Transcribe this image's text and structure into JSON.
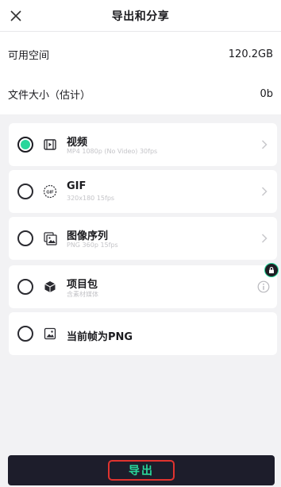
{
  "header": {
    "title": "导出和分享",
    "close_icon": "close-icon"
  },
  "info": {
    "space_label": "可用空间",
    "space_value": "120.2GB",
    "size_label": "文件大小（估计）",
    "size_value": "0b"
  },
  "options": [
    {
      "name": "视频",
      "desc": "MP4 1080p (No Video) 30fps",
      "icon": "video-icon",
      "selected": true,
      "trailing": "chevron-right-icon"
    },
    {
      "name": "GIF",
      "desc": "320x180 15fps",
      "icon": "gif-icon",
      "selected": false,
      "trailing": "chevron-right-icon"
    },
    {
      "name": "图像序列",
      "desc": "PNG 360p 15fps",
      "icon": "image-sequence-icon",
      "selected": false,
      "trailing": "chevron-right-icon"
    },
    {
      "name": "项目包",
      "desc": "含素材媒体",
      "icon": "package-icon",
      "selected": false,
      "trailing": "info-icon"
    },
    {
      "name": "当前帧为PNG",
      "desc": "",
      "icon": "image-icon",
      "selected": false,
      "trailing": ""
    }
  ],
  "export": {
    "label": "导出"
  },
  "colors": {
    "accent": "#29d69b",
    "export_bar": "#1d1d2b",
    "highlight_border": "#e0332f"
  }
}
